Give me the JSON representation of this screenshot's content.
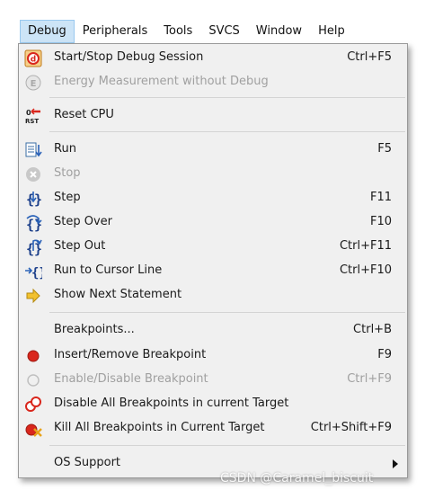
{
  "menubar": {
    "items": [
      "Debug",
      "Peripherals",
      "Tools",
      "SVCS",
      "Window",
      "Help"
    ]
  },
  "menu": {
    "items": [
      {
        "label": "Start/Stop Debug Session",
        "shortcut": "Ctrl+F5",
        "icon": "debug-session-icon",
        "enabled": true
      },
      {
        "label": "Energy Measurement without Debug",
        "shortcut": "",
        "icon": "energy-measurement-icon",
        "enabled": false
      },
      {
        "label": "Reset CPU",
        "shortcut": "",
        "icon": "reset-cpu-icon",
        "enabled": true
      },
      {
        "label": "Run",
        "shortcut": "F5",
        "icon": "run-icon",
        "enabled": true
      },
      {
        "label": "Stop",
        "shortcut": "",
        "icon": "stop-icon",
        "enabled": false
      },
      {
        "label": "Step",
        "shortcut": "F11",
        "icon": "step-icon",
        "enabled": true
      },
      {
        "label": "Step Over",
        "shortcut": "F10",
        "icon": "step-over-icon",
        "enabled": true
      },
      {
        "label": "Step Out",
        "shortcut": "Ctrl+F11",
        "icon": "step-out-icon",
        "enabled": true
      },
      {
        "label": "Run to Cursor Line",
        "shortcut": "Ctrl+F10",
        "icon": "run-to-cursor-icon",
        "enabled": true
      },
      {
        "label": "Show Next Statement",
        "shortcut": "",
        "icon": "arrow-right-icon",
        "enabled": true
      },
      {
        "label": "Breakpoints...",
        "shortcut": "Ctrl+B",
        "icon": "",
        "enabled": true
      },
      {
        "label": "Insert/Remove Breakpoint",
        "shortcut": "F9",
        "icon": "breakpoint-icon",
        "enabled": true
      },
      {
        "label": "Enable/Disable Breakpoint",
        "shortcut": "Ctrl+F9",
        "icon": "breakpoint-outline-icon",
        "enabled": false
      },
      {
        "label": "Disable All Breakpoints in current Target",
        "shortcut": "",
        "icon": "disable-breakpoints-icon",
        "enabled": true
      },
      {
        "label": "Kill All Breakpoints in Current Target",
        "shortcut": "Ctrl+Shift+F9",
        "icon": "kill-breakpoints-icon",
        "enabled": true
      },
      {
        "label": "OS Support",
        "shortcut": "",
        "icon": "",
        "enabled": true
      }
    ]
  },
  "watermark": "CSDN @Caramel_biscuit",
  "colors": {
    "menu_bg": "#f0f0f0",
    "active_menubar": "#cce4f7",
    "disabled_text": "#a0a0a0",
    "breakpoint_red": "#d9261c"
  }
}
